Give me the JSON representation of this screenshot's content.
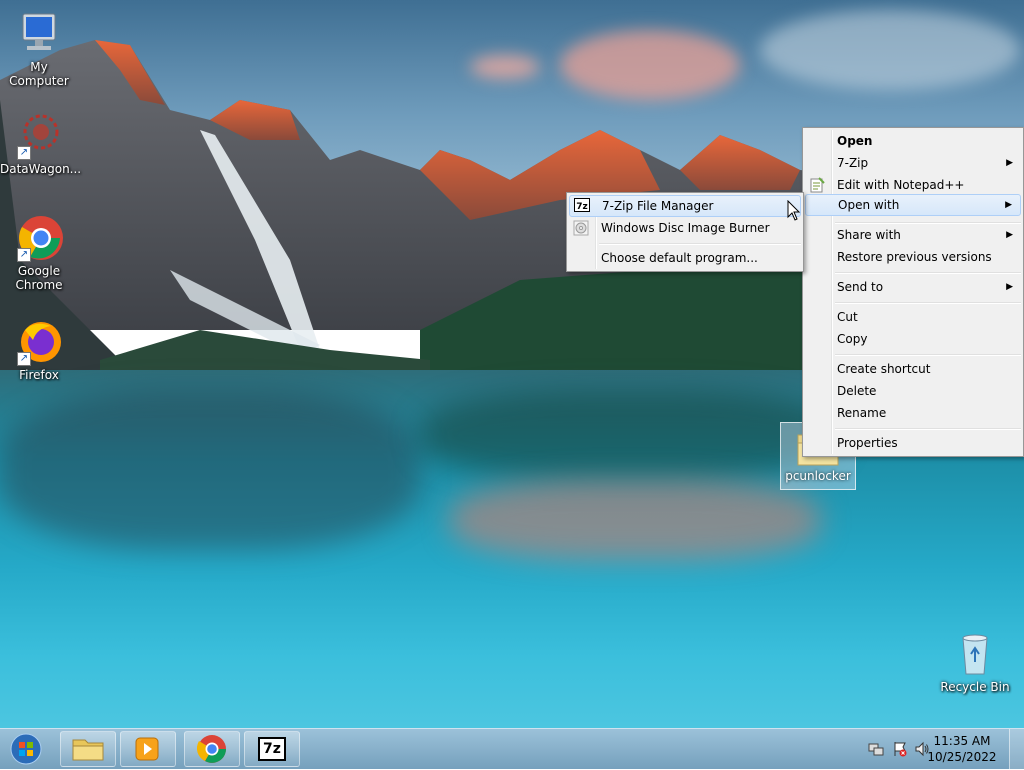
{
  "desktop_icons": [
    {
      "label": "My Computer",
      "icon": "computer-icon"
    },
    {
      "label": "DataWagon...",
      "icon": "datawagon-icon"
    },
    {
      "label": "Google Chrome",
      "icon": "chrome-icon"
    },
    {
      "label": "Firefox",
      "icon": "firefox-icon"
    },
    {
      "label": "Recycle Bin",
      "icon": "recycle-bin-icon"
    }
  ],
  "selected_file": {
    "label": "pcunlocker",
    "icon": "folder-icon"
  },
  "context_menu": {
    "items": {
      "open": "Open",
      "seven_zip": "7-Zip",
      "edit_notepad": "Edit with Notepad++",
      "open_with": "Open with",
      "share_with": "Share with",
      "restore": "Restore previous versions",
      "send_to": "Send to",
      "cut": "Cut",
      "copy": "Copy",
      "create_shortcut": "Create shortcut",
      "delete": "Delete",
      "rename": "Rename",
      "properties": "Properties"
    }
  },
  "open_with_submenu": {
    "items": {
      "seven_zip_fm": "7-Zip File Manager",
      "disc_burner": "Windows Disc Image Burner",
      "choose_default": "Choose default program..."
    }
  },
  "taskbar": {
    "seven_zip_label": "7z",
    "clock_time": "11:35 AM",
    "clock_date": "10/25/2022"
  },
  "colors": {
    "menu_bg": "#f0f0f0",
    "menu_highlight": "#d6e7fa",
    "taskbar": "#7ea8c6"
  }
}
